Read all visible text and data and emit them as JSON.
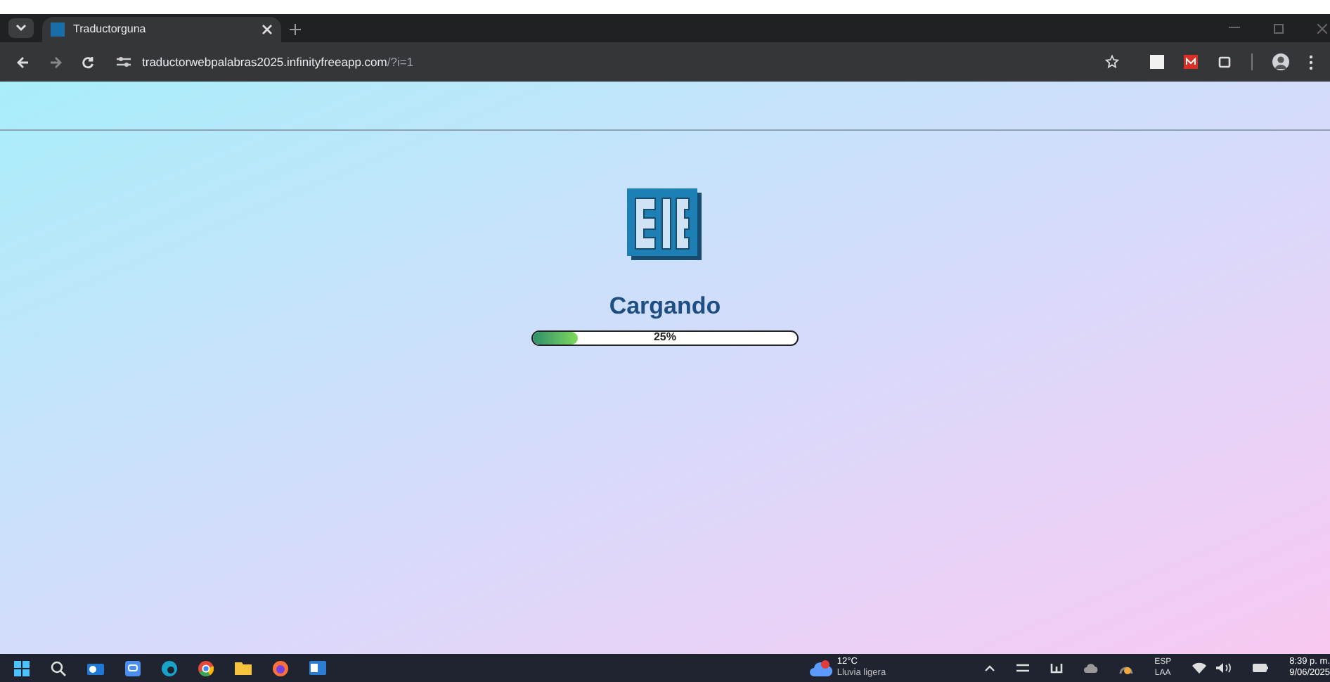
{
  "browser": {
    "tab": {
      "title": "Traductorguna",
      "selected": true
    },
    "url": {
      "host": "traductorwebpalabras2025.infinityfreeapp.com",
      "path": "/?i=1"
    }
  },
  "page": {
    "heading": "Cargando",
    "progress": {
      "level": 0.17,
      "label": "25%"
    }
  },
  "taskbar": {
    "weather": {
      "temp": "12°C",
      "desc": "Lluvia ligera"
    },
    "language": {
      "code": "ESP",
      "layout": "LAA"
    },
    "clock": {
      "time": "8:39 p. m.",
      "date": "9/06/2025"
    }
  }
}
